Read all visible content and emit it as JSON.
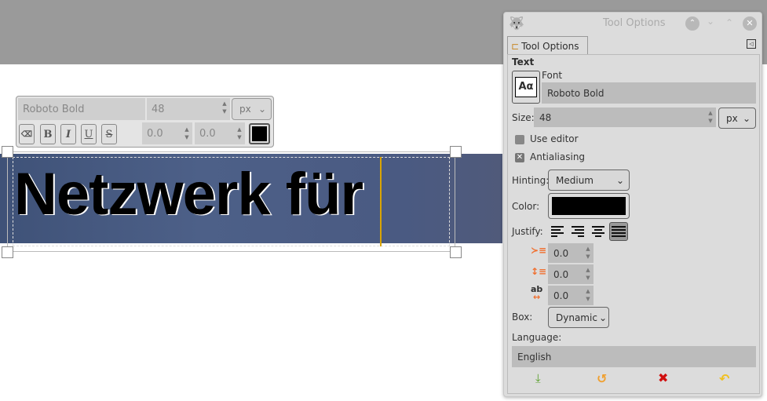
{
  "canvas": {
    "text": "Netzwerk für"
  },
  "on_canvas_bar": {
    "font": "Roboto Bold",
    "size": "48",
    "unit": "px",
    "baseline": "0.0",
    "kerning": "0.0",
    "color": "#000000",
    "style_buttons": [
      "B",
      "I",
      "U",
      "S"
    ]
  },
  "dialog": {
    "title": "Tool Options",
    "tab_label": "Tool Options",
    "section": "Text",
    "font_label": "Font",
    "font_preview": "Aα",
    "font_value": "Roboto Bold",
    "size_label": "Size:",
    "size_value": "48",
    "size_unit": "px",
    "use_editor_label": "Use editor",
    "antialiasing_label": "Antialiasing",
    "hinting_label": "Hinting:",
    "hinting_value": "Medium",
    "color_label": "Color:",
    "color_value": "#000000",
    "justify_label": "Justify:",
    "indent_value": "0.0",
    "line_spacing_value": "0.0",
    "letter_spacing_value": "0.0",
    "box_label": "Box:",
    "box_value": "Dynamic",
    "language_label": "Language:",
    "language_value": "English"
  }
}
